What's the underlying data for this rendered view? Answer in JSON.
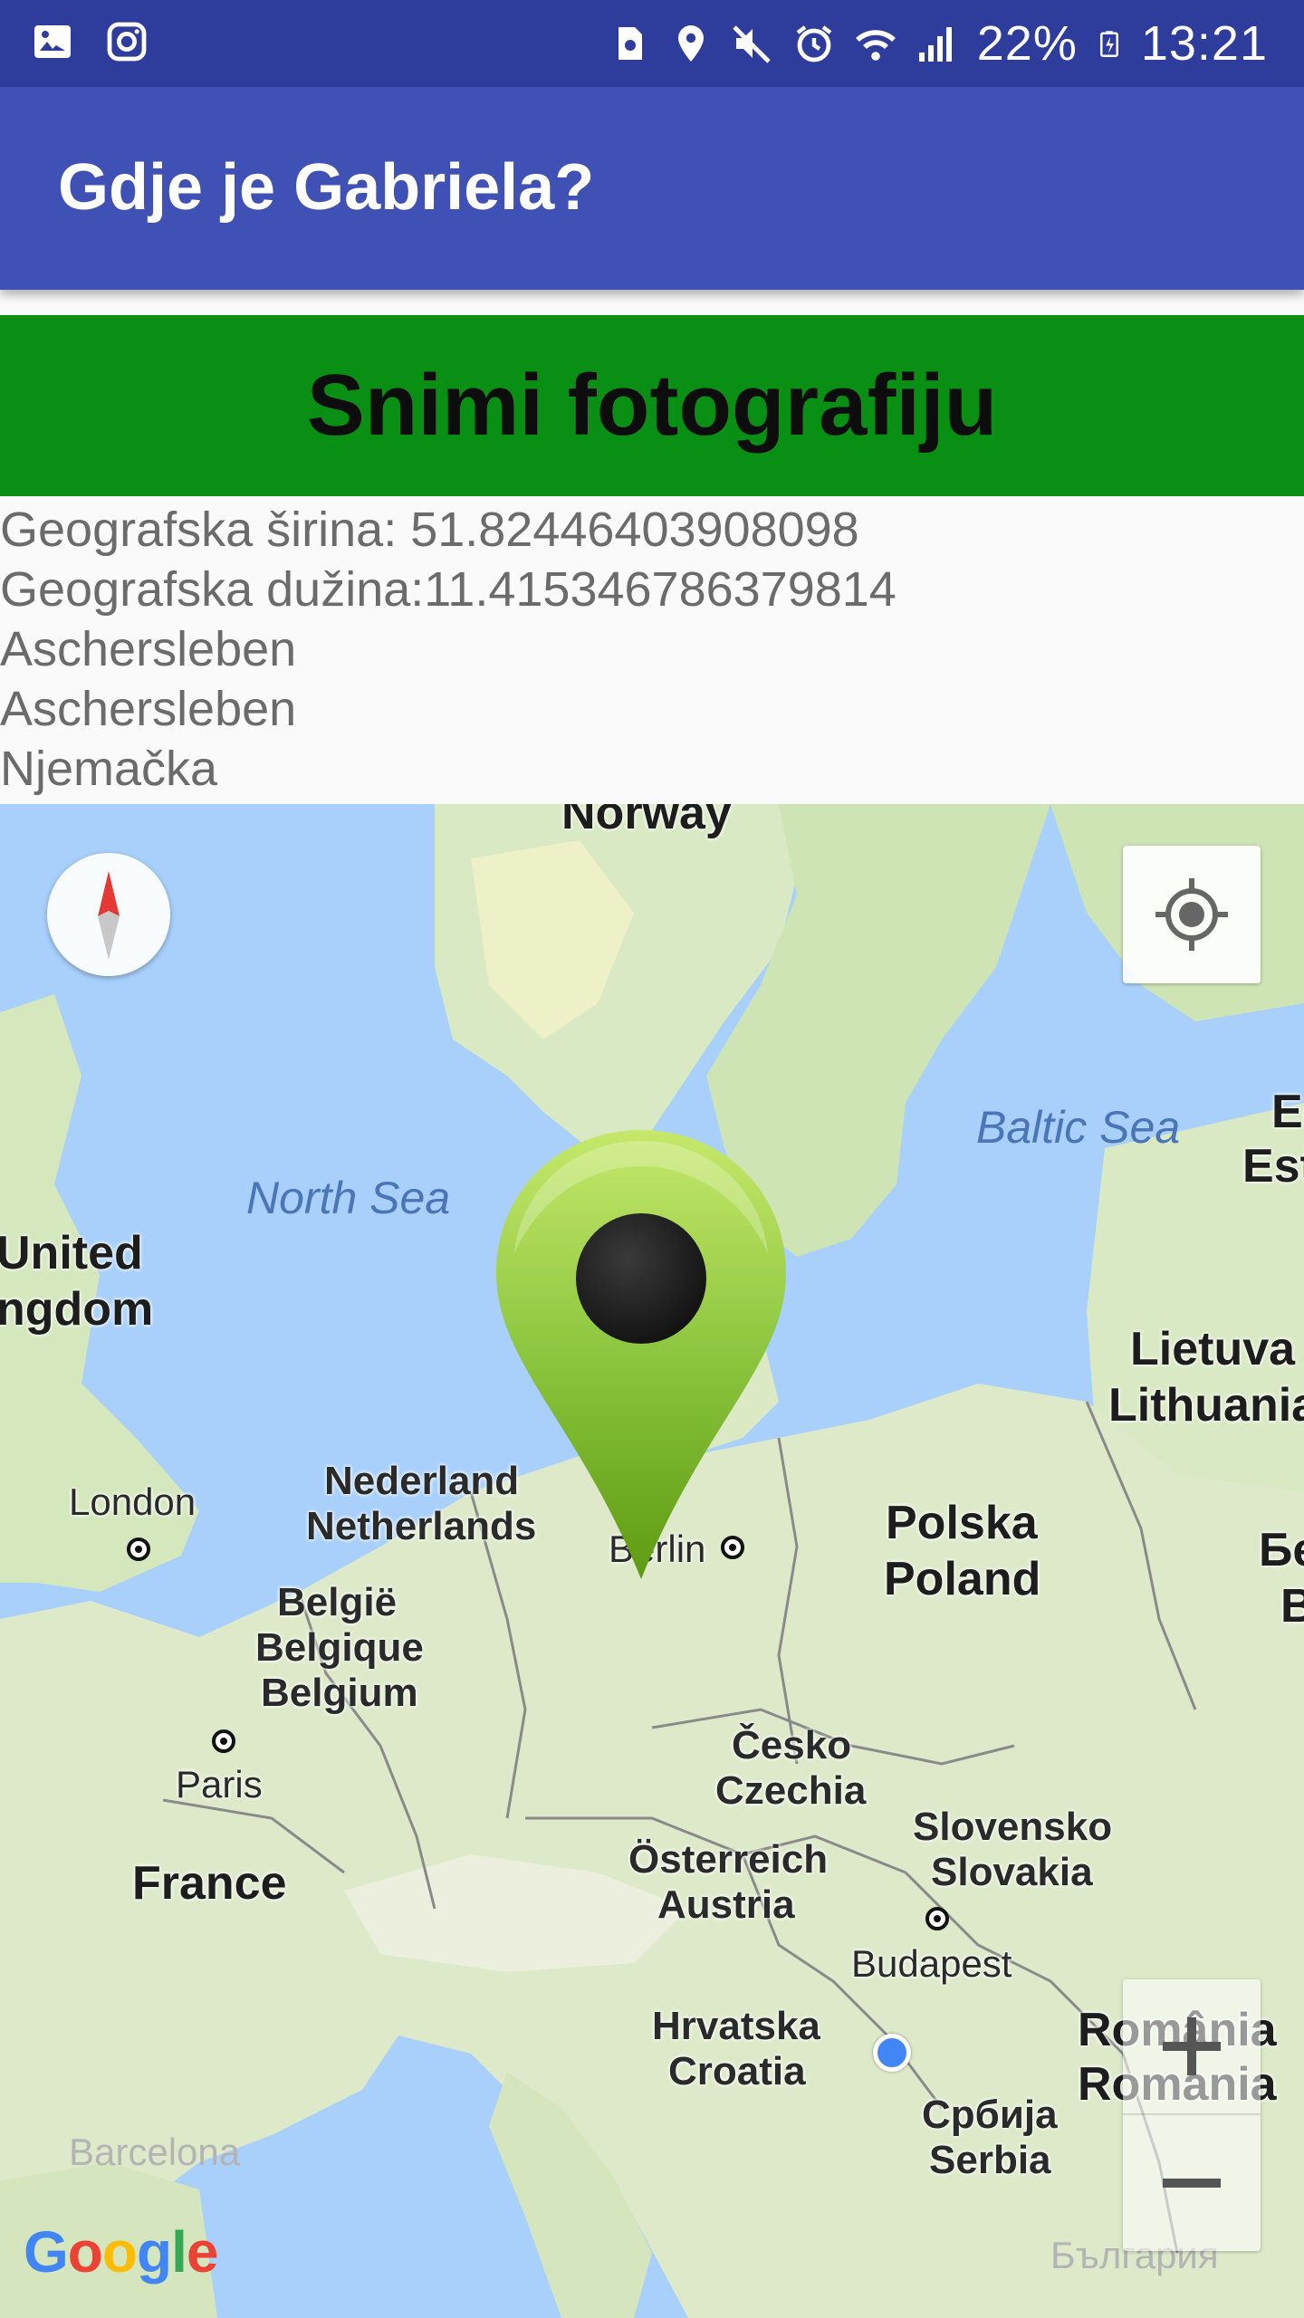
{
  "status_bar": {
    "left_icons": [
      "gallery-icon",
      "instagram-icon"
    ],
    "right_icons": [
      "storage-icon",
      "location-icon",
      "mute-icon",
      "alarm-icon",
      "wifi-icon",
      "signal-icon"
    ],
    "battery_percent": "22%",
    "time": "13:21"
  },
  "app_bar": {
    "title": "Gdje je Gabriela?"
  },
  "actions": {
    "snap_label": "Snimi fotografiju",
    "button_color": "#0a8f15"
  },
  "info": {
    "latitude": "Geografska širina: 51.82446403908098",
    "longitude": "Geografska dužina:11.415346786379814",
    "city": "Aschersleben",
    "locality": "Aschersleben",
    "country": "Njemačka"
  },
  "map": {
    "labels": {
      "norway": "Norway",
      "north_sea": "North Sea",
      "baltic_sea": "Baltic Sea",
      "estonia_1": "Ee",
      "estonia_2": "Est",
      "uk_1": "United",
      "uk_2": "ngdom",
      "lithuania_1": "Lietuva",
      "lithuania_2": "Lithuania",
      "netherlands_1": "Nederland",
      "netherlands_2": "Netherlands",
      "london": "London",
      "berlin": "Berlin",
      "poland_1": "Polska",
      "poland_2": "Poland",
      "belarus_1": "Бе",
      "belarus_2": "B",
      "belgium_1": "België",
      "belgium_2": "Belgique",
      "belgium_3": "Belgium",
      "paris": "Paris",
      "czechia_1": "Česko",
      "czechia_2": "Czechia",
      "slovakia_1": "Slovensko",
      "slovakia_2": "Slovakia",
      "france": "France",
      "austria_1": "Österreich",
      "austria_2": "Austria",
      "budapest": "Budapest",
      "croatia_1": "Hrvatska",
      "croatia_2": "Croatia",
      "romania_1": "România",
      "romania_2": "Romania",
      "serbia_1": "Србија",
      "serbia_2": "Serbia",
      "barcelona": "Barcelona",
      "bulgaria": "България"
    },
    "controls": {
      "zoom_in": "+",
      "zoom_out": "−"
    },
    "attribution": "Google",
    "marker_color": "#8cc63f"
  }
}
